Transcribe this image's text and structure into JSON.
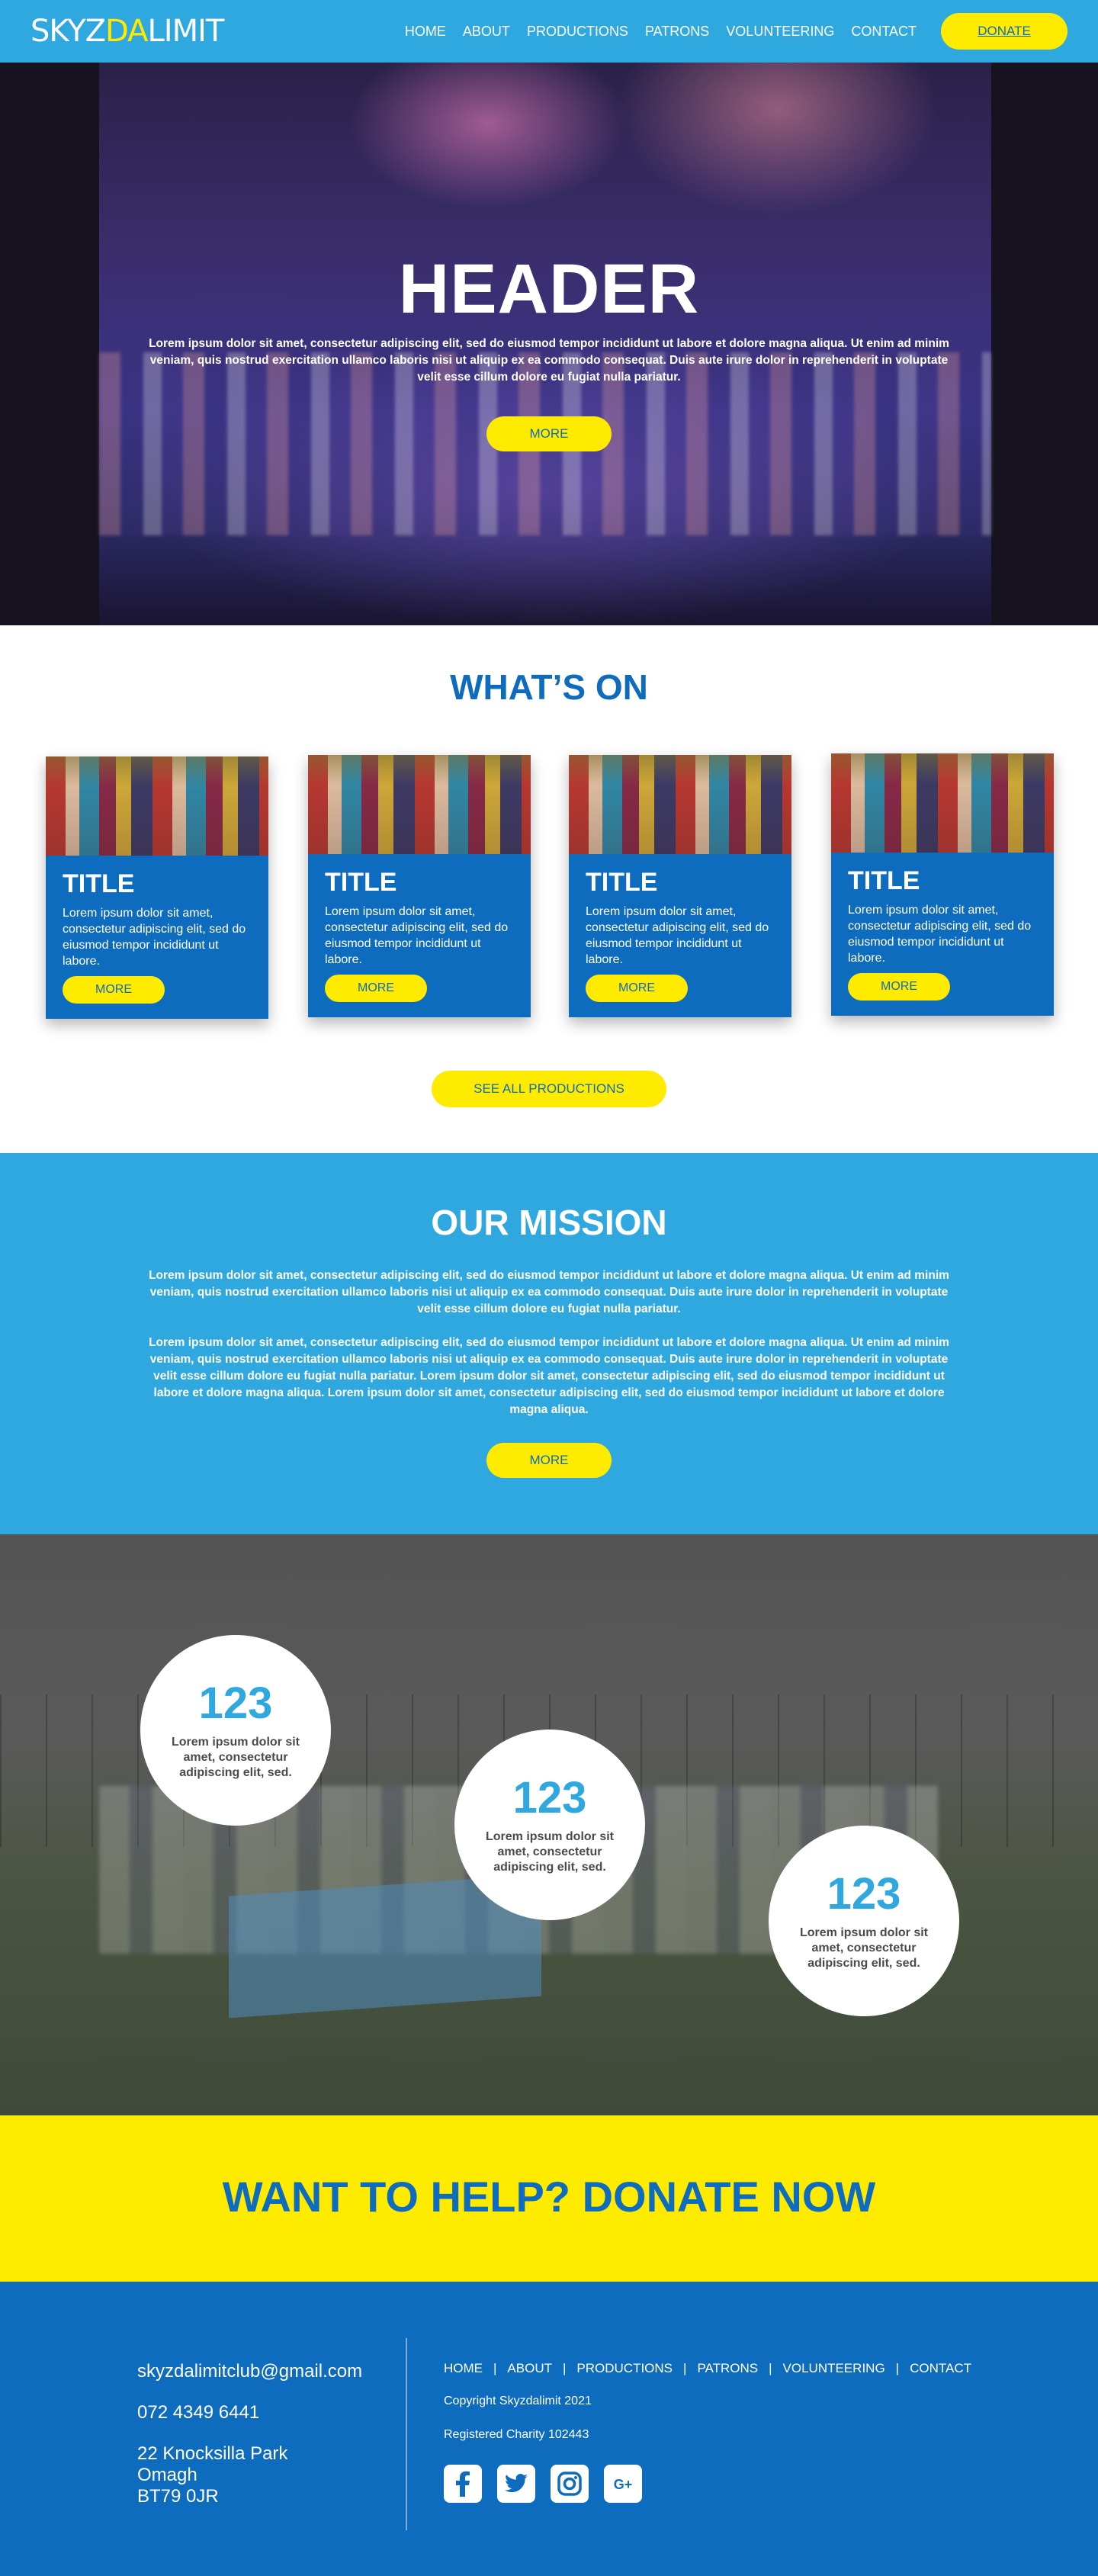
{
  "brand": {
    "logo_part1": "SKYZ",
    "logo_part2": "DA",
    "logo_part3": "LIMIT"
  },
  "nav": {
    "links": [
      "HOME",
      "ABOUT",
      "PRODUCTIONS",
      "PATRONS",
      "VOLUNTEERING",
      "CONTACT"
    ],
    "donate_label": "DONATE"
  },
  "hero": {
    "title": "HEADER",
    "text": "Lorem ipsum dolor sit amet, consectetur adipiscing elit, sed do eiusmod tempor incididunt ut labore et dolore magna aliqua. Ut enim ad minim veniam, quis nostrud exercitation ullamco laboris nisi ut aliquip ex ea commodo consequat. Duis aute irure dolor in reprehenderit in voluptate velit esse cillum dolore eu fugiat nulla pariatur.",
    "button": "MORE"
  },
  "whats_on": {
    "title": "WHAT’S ON",
    "cards": [
      {
        "title": "TITLE",
        "text": "Lorem ipsum dolor sit amet, consectetur adipiscing elit, sed do eiusmod tempor incididunt ut labore.",
        "button": "MORE"
      },
      {
        "title": "TITLE",
        "text": "Lorem ipsum dolor sit amet, consectetur adipiscing elit, sed do eiusmod tempor incididunt ut labore.",
        "button": "MORE"
      },
      {
        "title": "TITLE",
        "text": "Lorem ipsum dolor sit amet, consectetur adipiscing elit, sed do eiusmod tempor incididunt ut labore.",
        "button": "MORE"
      },
      {
        "title": "TITLE",
        "text": "Lorem ipsum dolor sit amet, consectetur adipiscing elit, sed do eiusmod tempor incididunt ut labore.",
        "button": "MORE"
      }
    ],
    "see_all": "SEE ALL PRODUCTIONS"
  },
  "mission": {
    "title": "OUR MISSION",
    "p1": "Lorem ipsum dolor sit amet, consectetur adipiscing elit, sed do eiusmod tempor incididunt ut labore et dolore magna aliqua. Ut enim ad minim veniam, quis nostrud exercitation ullamco laboris nisi ut aliquip ex ea commodo consequat. Duis aute irure dolor in reprehenderit in voluptate velit esse cillum dolore eu fugiat nulla pariatur.",
    "p2": "Lorem ipsum dolor sit amet, consectetur adipiscing elit, sed do eiusmod tempor incididunt ut labore et dolore magna aliqua. Ut enim ad minim veniam, quis nostrud exercitation ullamco laboris nisi ut aliquip ex ea commodo consequat. Duis aute irure dolor in reprehenderit in voluptate velit esse cillum dolore eu fugiat nulla pariatur. Lorem ipsum dolor sit amet, consectetur adipiscing elit, sed do eiusmod tempor incididunt ut labore et dolore magna aliqua. Lorem ipsum dolor sit amet, consectetur adipiscing elit, sed do eiusmod tempor incididunt ut labore et dolore magna aliqua.",
    "button": "MORE"
  },
  "stats": [
    {
      "number": "123",
      "label": "Lorem ipsum dolor sit amet, consectetur adipiscing elit, sed."
    },
    {
      "number": "123",
      "label": "Lorem ipsum dolor sit amet, consectetur adipiscing elit, sed."
    },
    {
      "number": "123",
      "label": "Lorem ipsum dolor sit amet, consectetur adipiscing elit, sed."
    }
  ],
  "donate_band": {
    "title": "WANT TO HELP? DONATE NOW"
  },
  "footer": {
    "email": "skyzdalimitclub@gmail.com",
    "phone": "072 4349 6441",
    "address": [
      "22 Knocksilla Park",
      "Omagh",
      "BT79 0JR"
    ],
    "links": [
      "HOME",
      "ABOUT",
      "PRODUCTIONS",
      "PATRONS",
      "VOLUNTEERING",
      "CONTACT"
    ],
    "separator": "|",
    "copyright": "Copyright Skyzdalimit 2021",
    "charity": "Registered Charity 102443",
    "social_icons": [
      "facebook-icon",
      "twitter-icon",
      "instagram-icon",
      "google-plus-icon"
    ],
    "social_gplus_text": "G+"
  },
  "colors": {
    "primary_blue": "#0e6cbf",
    "sky_blue": "#2fa8e0",
    "yellow": "#ffeb00"
  }
}
